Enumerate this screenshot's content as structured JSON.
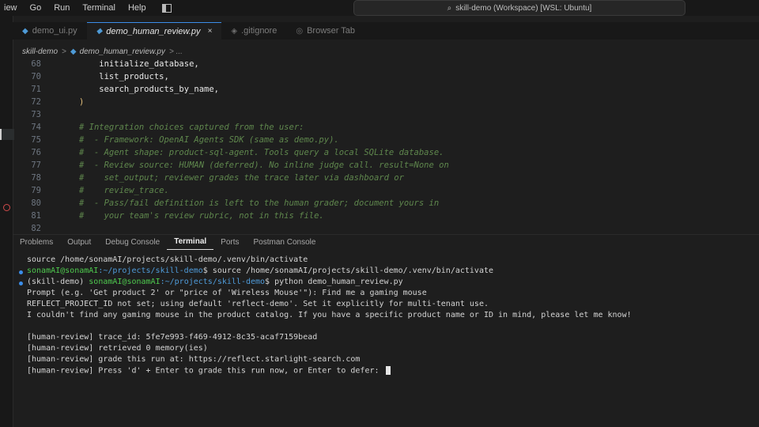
{
  "titlebar": {
    "menu": [
      "iew",
      "Go",
      "Run",
      "Terminal",
      "Help"
    ],
    "command_center": "skill-demo (Workspace) [WSL: Ubuntu]"
  },
  "tabs": [
    {
      "label": "demo_ui.py",
      "icon": "python-icon",
      "active": false
    },
    {
      "label": "demo_human_review.py",
      "icon": "python-icon",
      "active": true,
      "close": "×"
    },
    {
      "label": ".gitignore",
      "icon": "gitignore-icon",
      "active": false
    },
    {
      "label": "Browser Tab",
      "icon": "browser-icon",
      "active": false
    }
  ],
  "breadcrumb": {
    "folder": "skill-demo",
    "sep": ">",
    "file": "demo_human_review.py",
    "tail": "> ..."
  },
  "editor": {
    "lines": [
      {
        "n": "68",
        "text": "    initialize_database,",
        "kind": "ident"
      },
      {
        "n": "70",
        "text": "    list_products,",
        "kind": "ident"
      },
      {
        "n": "71",
        "text": "    search_products_by_name,",
        "kind": "ident"
      },
      {
        "n": "72",
        "text": ")",
        "kind": "punct"
      },
      {
        "n": "73",
        "text": "",
        "kind": "ident"
      },
      {
        "n": "74",
        "text": "# Integration choices captured from the user:",
        "kind": "comment"
      },
      {
        "n": "75",
        "text": "#  - Framework: OpenAI Agents SDK (same as demo.py).",
        "kind": "comment"
      },
      {
        "n": "76",
        "text": "#  - Agent shape: product-sql-agent. Tools query a local SQLite database.",
        "kind": "comment"
      },
      {
        "n": "77",
        "text": "#  - Review source: HUMAN (deferred). No inline judge call. result=None on",
        "kind": "comment"
      },
      {
        "n": "78",
        "text": "#    set_output; reviewer grades the trace later via dashboard or",
        "kind": "comment"
      },
      {
        "n": "79",
        "text": "#    review_trace.",
        "kind": "comment"
      },
      {
        "n": "80",
        "text": "#  - Pass/fail definition is left to the human grader; document yours in",
        "kind": "comment"
      },
      {
        "n": "81",
        "text": "#    your team's review rubric, not in this file.",
        "kind": "comment"
      },
      {
        "n": "82",
        "text": "",
        "kind": "ident"
      }
    ]
  },
  "panel": {
    "tabs": [
      "Problems",
      "Output",
      "Debug Console",
      "Terminal",
      "Ports",
      "Postman Console"
    ],
    "active": "Terminal"
  },
  "terminal": {
    "line1": "source /home/sonamAI/projects/skill-demo/.venv/bin/activate",
    "line2_user": "sonamAI@sonamAI",
    "line2_path": ":~/projects/skill-demo",
    "line2_cmd": "$ source /home/sonamAI/projects/skill-demo/.venv/bin/activate",
    "line3_env": "(skill-demo) ",
    "line3_user": "sonamAI@sonamAI",
    "line3_path": ":~/projects/skill-demo",
    "line3_cmd": "$ python demo_human_review.py",
    "line4": "Prompt (e.g. 'Get product 2' or \"price of 'Wireless Mouse'\"): Find me a gaming mouse",
    "line5": "REFLECT_PROJECT_ID not set; using default 'reflect-demo'. Set it explicitly for multi-tenant use.",
    "line6": "I couldn't find any gaming mouse in the product catalog. If you have a specific product name or ID in mind, please let me know!",
    "line7": "[human-review] trace_id: 5fe7e993-f469-4912-8c35-acaf7159bead",
    "line8": "[human-review] retrieved 0 memory(ies)",
    "line9": "[human-review] grade this run at: https://reflect.starlight-search.com",
    "line10": "[human-review] Press 'd' + Enter to grade this run now, or Enter to defer: "
  }
}
